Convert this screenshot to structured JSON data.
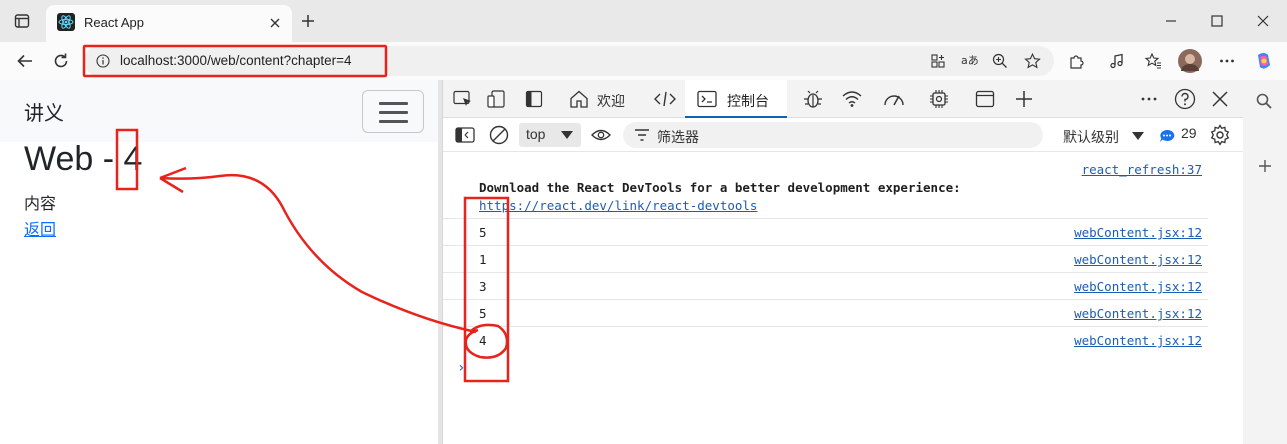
{
  "browser": {
    "tab_title": "React App",
    "url": "localhost:3000/web/content?chapter=4"
  },
  "page": {
    "brand": "讲义",
    "title": "Web - 4",
    "content_label": "内容",
    "back_link": "返回"
  },
  "devtools": {
    "tabs": {
      "welcome": "欢迎",
      "console": "控制台"
    },
    "filterbar": {
      "context": "top",
      "filter_placeholder": "筛选器",
      "levels": "默认级别",
      "issue_count": "29"
    },
    "console": {
      "refresh_source": "react_refresh:37",
      "devtools_message": "Download the React DevTools for a better development experience:",
      "devtools_link": "https://react.dev/link/react-devtools",
      "logs": [
        {
          "value": "5",
          "source": "webContent.jsx:12"
        },
        {
          "value": "1",
          "source": "webContent.jsx:12"
        },
        {
          "value": "3",
          "source": "webContent.jsx:12"
        },
        {
          "value": "5",
          "source": "webContent.jsx:12"
        },
        {
          "value": "4",
          "source": "webContent.jsx:12"
        }
      ],
      "prompt": "›"
    }
  },
  "colors": {
    "annotation": "#e8231b",
    "link": "#1a5db4",
    "page_link": "#0d6efd"
  }
}
